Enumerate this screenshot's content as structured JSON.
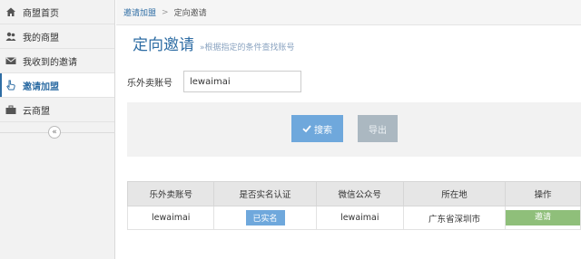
{
  "sidebar": {
    "items": [
      {
        "label": "商盟首页",
        "icon": "home-icon",
        "active": false
      },
      {
        "label": "我的商盟",
        "icon": "users-icon",
        "active": false
      },
      {
        "label": "我收到的邀请",
        "icon": "envelope-icon",
        "active": false
      },
      {
        "label": "邀请加盟",
        "icon": "hand-pointer-icon",
        "active": true
      },
      {
        "label": "云商盟",
        "icon": "briefcase-icon",
        "active": false
      }
    ],
    "collapse_glyph": "«"
  },
  "breadcrumb": {
    "link": "邀请加盟",
    "separator": ">",
    "current": "定向邀请"
  },
  "header": {
    "title": "定向邀请",
    "subtitle": "»根据指定的条件查找账号"
  },
  "search": {
    "label": "乐外卖账号",
    "value": "lewaimai"
  },
  "buttons": {
    "search": "搜索",
    "export": "导出"
  },
  "table": {
    "headers": [
      "乐外卖账号",
      "是否实名认证",
      "微信公众号",
      "所在地",
      "操作"
    ],
    "rows": [
      {
        "account": "lewaimai",
        "verified": "已实名",
        "wechat": "lewaimai",
        "location": "广东省深圳市",
        "action": "邀请"
      }
    ]
  },
  "colors": {
    "accent": "#2e6da4",
    "search_button": "#6fa8dc",
    "export_button": "#abb8c1",
    "invite_button": "#8fbf7a"
  }
}
